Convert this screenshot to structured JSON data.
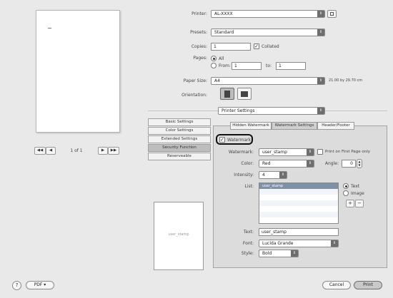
{
  "printer": {
    "label": "Printer:",
    "value": "AL-XXXX"
  },
  "presets": {
    "label": "Presets:",
    "value": "Standard"
  },
  "copies": {
    "label": "Copies:",
    "value": "1",
    "collated_label": "Collated",
    "collated": true
  },
  "pages": {
    "label": "Pages:",
    "all_label": "All",
    "from_label": "From:",
    "from_value": "1",
    "to_label": "to:",
    "to_value": "1"
  },
  "paper_size": {
    "label": "Paper Size:",
    "value": "A4",
    "dimensions": "21.00 by 29.70 cm"
  },
  "orientation": {
    "label": "Orientation:"
  },
  "panel_select": {
    "value": "Printer Settings"
  },
  "preview": {
    "page_indicator": "1 of 1",
    "first": "◀◀",
    "prev": "◀",
    "next": "▶",
    "last": "▶▶",
    "thumb_text": "user_stamp"
  },
  "side_menu": [
    "Basic Settings",
    "Color Settings",
    "Extended Settings",
    "Security Function",
    "Reserveable"
  ],
  "tabs": [
    "Hidden Watermark",
    "Watermark Settings",
    "Header/Footer"
  ],
  "watermark": {
    "checkbox_label": "Watermark",
    "type_label": "Watermark:",
    "type_value": "user_stamp",
    "first_page_label": "Print on First Page only",
    "color_label": "Color:",
    "color_value": "Red",
    "angle_label": "Angle:",
    "angle_value": "0",
    "intensity_label": "Intensity:",
    "intensity_value": "4",
    "list_label": "List:",
    "list_items": [
      "user_stamp"
    ],
    "text_option": "Text",
    "image_option": "Image",
    "add": "+",
    "remove": "−",
    "text_label": "Text:",
    "text_value": "user_stamp",
    "font_label": "Font:",
    "font_value": "Lucida Grande",
    "style_label": "Style:",
    "style_value": "Bold"
  },
  "footer": {
    "help": "?",
    "pdf": "PDF ▾",
    "cancel": "Cancel",
    "print": "Print"
  }
}
